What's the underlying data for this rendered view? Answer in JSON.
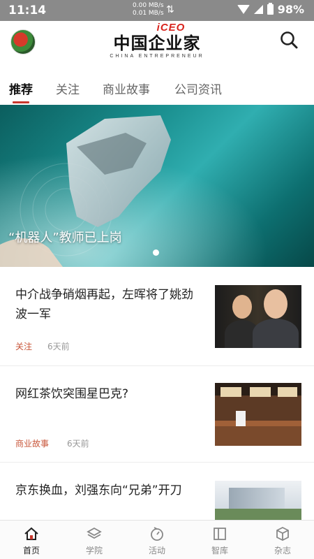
{
  "status_bar": {
    "time": "11:14",
    "net_up": "0.00 MB/s",
    "net_down": "0.01 MB/s",
    "battery": "98%"
  },
  "header": {
    "logo_mark": "iCEO",
    "logo_text": "中国企业家",
    "logo_subtext": "CHINA ENTREPRENEUR"
  },
  "tabs": [
    {
      "label": "推荐",
      "active": true
    },
    {
      "label": "关注",
      "active": false
    },
    {
      "label": "商业故事",
      "active": false
    },
    {
      "label": "公司资讯",
      "active": false
    }
  ],
  "banner": {
    "title": "“机器人”教师已上岗"
  },
  "articles": [
    {
      "title": "中介战争硝烟再起，左晖将了姚劲波一军",
      "tag": "关注",
      "time": "6天前"
    },
    {
      "title": "网红茶饮突围星巴克?",
      "tag": "商业故事",
      "time": "6天前"
    },
    {
      "title": "京东换血，刘强东向“兄弟”开刀",
      "tag": "",
      "time": ""
    }
  ],
  "bottom_nav": [
    {
      "label": "首页",
      "icon": "home-icon",
      "active": true
    },
    {
      "label": "学院",
      "icon": "layers-icon",
      "active": false
    },
    {
      "label": "活动",
      "icon": "activity-icon",
      "active": false
    },
    {
      "label": "智库",
      "icon": "book-icon",
      "active": false
    },
    {
      "label": "杂志",
      "icon": "box-icon",
      "active": false
    }
  ],
  "colors": {
    "accent": "#c8372d",
    "tag": "#c8563a",
    "status_bar": "#8a8a8a"
  }
}
